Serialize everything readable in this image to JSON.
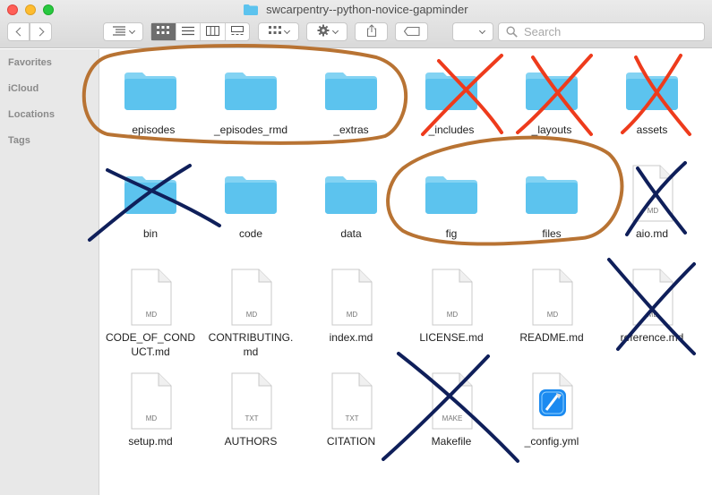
{
  "window": {
    "title": "swcarpentry--python-novice-gapminder"
  },
  "toolbar": {
    "search_placeholder": "Search"
  },
  "sidebar": {
    "items": [
      {
        "label": "Favorites"
      },
      {
        "label": "iCloud"
      },
      {
        "label": "Locations"
      },
      {
        "label": "Tags"
      }
    ]
  },
  "files": {
    "items": [
      {
        "name": "_episodes",
        "type": "folder"
      },
      {
        "name": "_episodes_rmd",
        "type": "folder"
      },
      {
        "name": "_extras",
        "type": "folder"
      },
      {
        "name": "_includes",
        "type": "folder"
      },
      {
        "name": "_layouts",
        "type": "folder"
      },
      {
        "name": "assets",
        "type": "folder"
      },
      {
        "name": "bin",
        "type": "folder"
      },
      {
        "name": "code",
        "type": "folder"
      },
      {
        "name": "data",
        "type": "folder"
      },
      {
        "name": "fig",
        "type": "folder"
      },
      {
        "name": "files",
        "type": "folder"
      },
      {
        "name": "aio.md",
        "type": "doc",
        "badge": "MD"
      },
      {
        "name": "CODE_OF_CONDUCT.md",
        "display": [
          "CODE_OF_COND",
          "UCT.md"
        ],
        "type": "doc",
        "badge": "MD"
      },
      {
        "name": "CONTRIBUTING.md",
        "display": [
          "CONTRIBUTING.",
          "md"
        ],
        "type": "doc",
        "badge": "MD"
      },
      {
        "name": "index.md",
        "type": "doc",
        "badge": "MD"
      },
      {
        "name": "LICENSE.md",
        "type": "doc",
        "badge": "MD"
      },
      {
        "name": "README.md",
        "type": "doc",
        "badge": "MD"
      },
      {
        "name": "reference.md",
        "type": "doc",
        "badge": "MD"
      },
      {
        "name": "setup.md",
        "type": "doc",
        "badge": "MD"
      },
      {
        "name": "AUTHORS",
        "type": "doc",
        "badge": "TXT"
      },
      {
        "name": "CITATION",
        "type": "doc",
        "badge": "TXT"
      },
      {
        "name": "Makefile",
        "type": "doc",
        "badge": "MAKE"
      },
      {
        "name": "_config.yml",
        "type": "xcode"
      }
    ]
  },
  "annotations": {
    "circle_color": "#b87333",
    "red_x_color": "#ee3b1c",
    "blue_x_color": "#0f1f5a",
    "circled": [
      "_episodes",
      "_episodes_rmd",
      "_extras",
      "fig",
      "files"
    ],
    "red_crossed": [
      "_includes",
      "_layouts",
      "assets"
    ],
    "blue_crossed": [
      "bin",
      "aio.md",
      "reference.md",
      "Makefile"
    ]
  },
  "colors": {
    "folder": "#5cc3ee",
    "folder_tab": "#83d3f3",
    "sidebar": "#e8e8e8"
  }
}
